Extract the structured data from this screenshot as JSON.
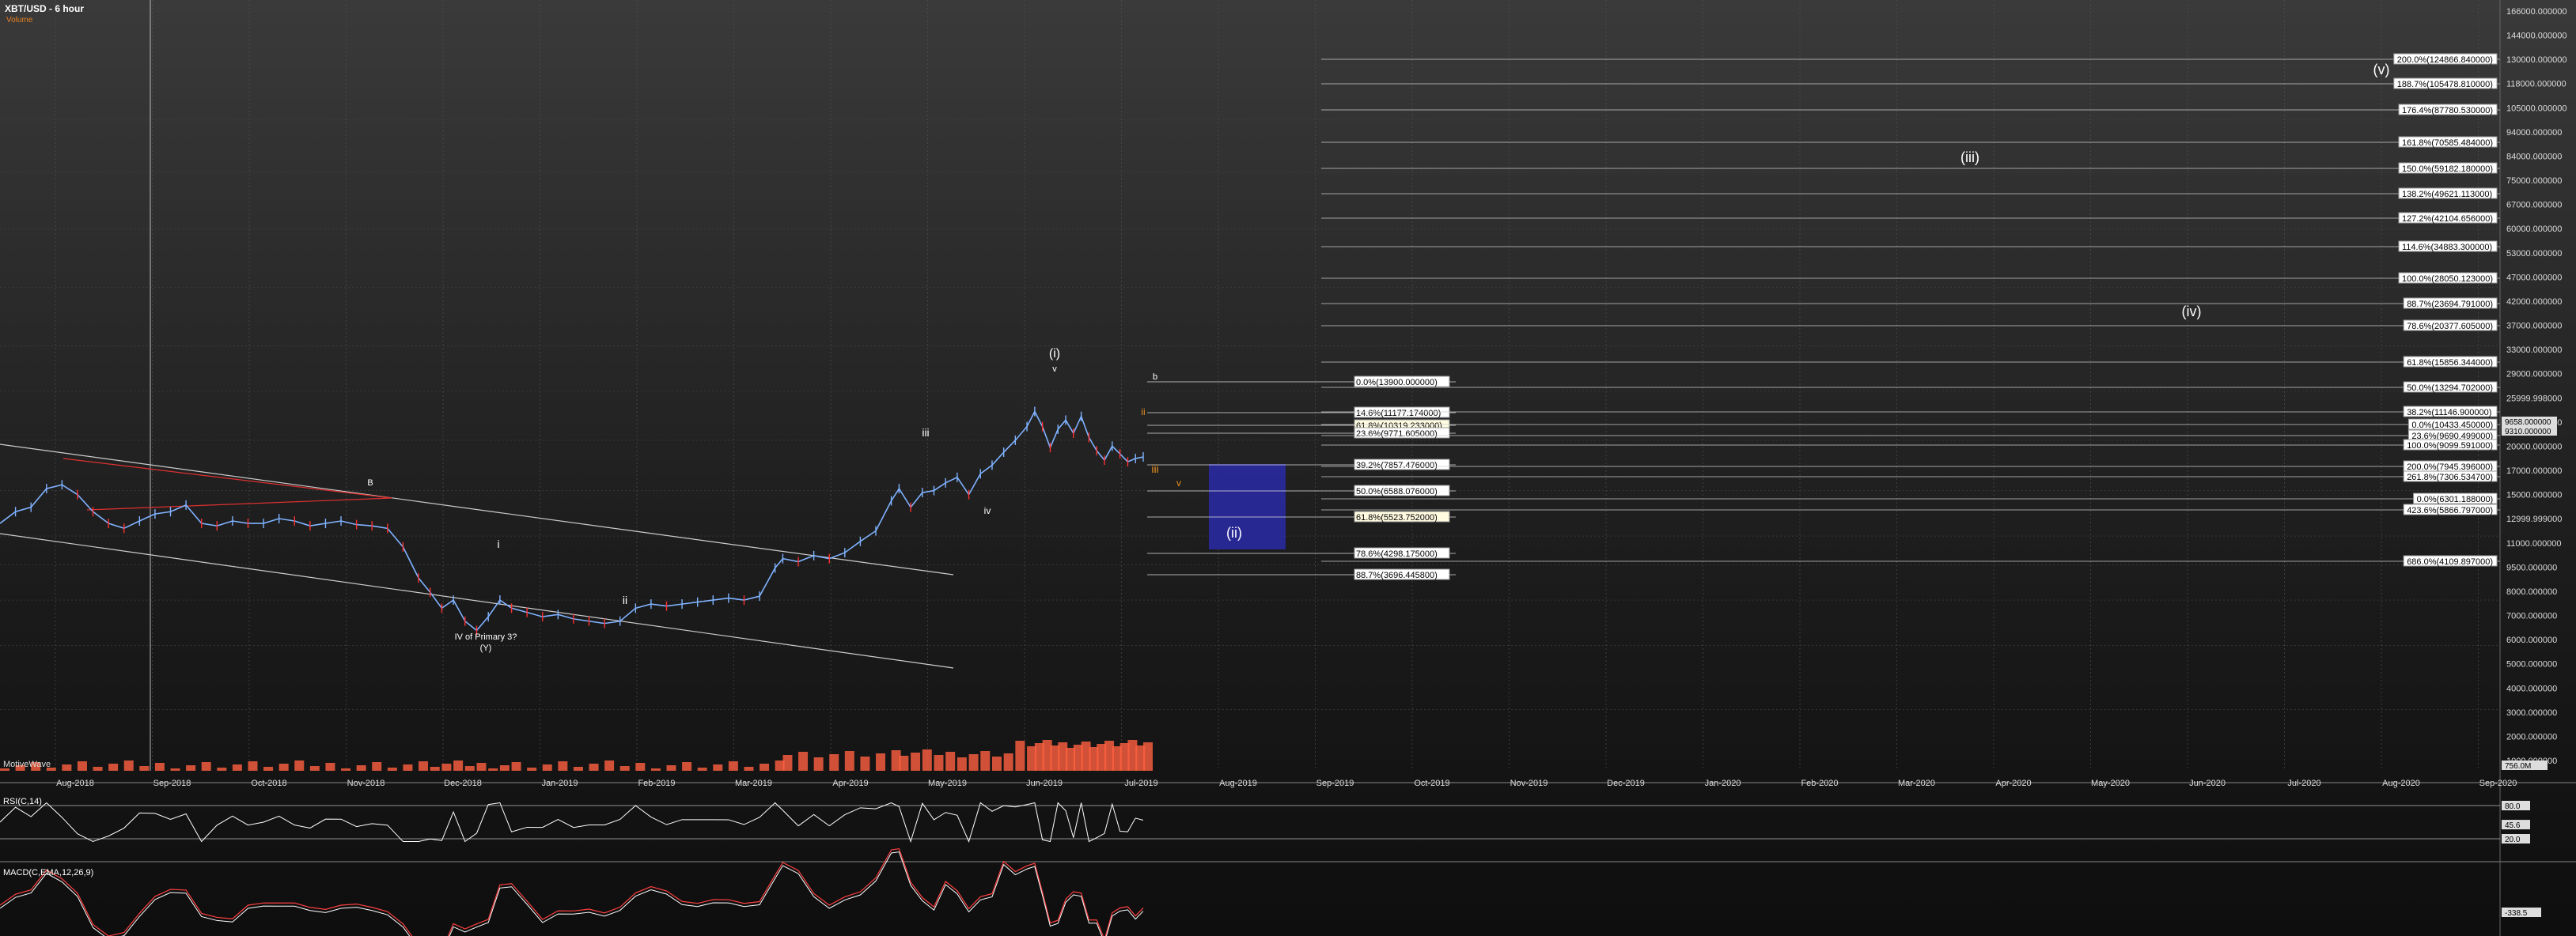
{
  "title": "XBT/USD - 6 hour",
  "subtitle": "Volume",
  "watermark": "MotiveWave",
  "panes": {
    "rsi_label": "RSI(C,14)",
    "macd_label": "MACD(C,EMA,12,26,9)"
  },
  "colors": {
    "bg": "#1e1e1e",
    "up": "#7fb2ff",
    "down": "#ff3030",
    "fib_box": "#2a2aa8",
    "orange": "#e8901e"
  },
  "chart_data": {
    "type": "line",
    "title": "XBT/USD - 6 hour",
    "y_scale": "log",
    "ylim": [
      1500,
      170000
    ],
    "x_ticks": [
      "Aug-2018",
      "Sep-2018",
      "Oct-2018",
      "Nov-2018",
      "Dec-2018",
      "Jan-2019",
      "Feb-2019",
      "Mar-2019",
      "Apr-2019",
      "May-2019",
      "Jun-2019",
      "Jul-2019",
      "Aug-2019",
      "Sep-2019",
      "Oct-2019",
      "Nov-2019",
      "Dec-2019",
      "Jan-2020",
      "Feb-2020",
      "Mar-2020",
      "Apr-2020",
      "May-2020",
      "Jun-2020",
      "Jul-2020",
      "Aug-2020",
      "Sep-2020"
    ],
    "y_ticks": [
      "166000.000000",
      "144000.000000",
      "130000.000000",
      "118000.000000",
      "105000.000000",
      "94000.000000",
      "84000.000000",
      "75000.000000",
      "67000.000000",
      "60000.000000",
      "53000.000000",
      "47000.000000",
      "42000.000000",
      "37000.000000",
      "33000.000000",
      "29000.000000",
      "25999.998000",
      "23000.000000",
      "20000.000000",
      "17000.000000",
      "15000.000000",
      "12999.999000",
      "11000.000000",
      "9500.000000",
      "8000.000000",
      "7000.000000",
      "6000.000000",
      "5000.000000",
      "4000.000000",
      "3000.000000",
      "2000.000000",
      "1000.000000"
    ],
    "price_badges": [
      "9658.000000",
      "9310.000000"
    ],
    "volume_badge": "756.0M",
    "rsi_badges": [
      "80.0",
      "45.6",
      "20.0"
    ],
    "macd_badge": "-338.5",
    "price": [
      {
        "x": 0,
        "y": 6500
      },
      {
        "x": 20,
        "y": 7000
      },
      {
        "x": 40,
        "y": 7200
      },
      {
        "x": 60,
        "y": 8100
      },
      {
        "x": 80,
        "y": 8300
      },
      {
        "x": 100,
        "y": 7800
      },
      {
        "x": 120,
        "y": 7000
      },
      {
        "x": 140,
        "y": 6500
      },
      {
        "x": 160,
        "y": 6300
      },
      {
        "x": 180,
        "y": 6600
      },
      {
        "x": 200,
        "y": 6900
      },
      {
        "x": 220,
        "y": 7000
      },
      {
        "x": 240,
        "y": 7300
      },
      {
        "x": 260,
        "y": 6500
      },
      {
        "x": 280,
        "y": 6400
      },
      {
        "x": 300,
        "y": 6600
      },
      {
        "x": 320,
        "y": 6500
      },
      {
        "x": 340,
        "y": 6500
      },
      {
        "x": 360,
        "y": 6700
      },
      {
        "x": 380,
        "y": 6600
      },
      {
        "x": 400,
        "y": 6400
      },
      {
        "x": 420,
        "y": 6500
      },
      {
        "x": 440,
        "y": 6600
      },
      {
        "x": 460,
        "y": 6450
      },
      {
        "x": 480,
        "y": 6400
      },
      {
        "x": 500,
        "y": 6300
      },
      {
        "x": 520,
        "y": 5600
      },
      {
        "x": 540,
        "y": 4600
      },
      {
        "x": 555,
        "y": 4200
      },
      {
        "x": 570,
        "y": 3800
      },
      {
        "x": 585,
        "y": 4000
      },
      {
        "x": 600,
        "y": 3500
      },
      {
        "x": 615,
        "y": 3300
      },
      {
        "x": 630,
        "y": 3600
      },
      {
        "x": 645,
        "y": 4000
      },
      {
        "x": 660,
        "y": 3800
      },
      {
        "x": 680,
        "y": 3700
      },
      {
        "x": 700,
        "y": 3600
      },
      {
        "x": 720,
        "y": 3650
      },
      {
        "x": 740,
        "y": 3550
      },
      {
        "x": 760,
        "y": 3500
      },
      {
        "x": 780,
        "y": 3450
      },
      {
        "x": 800,
        "y": 3500
      },
      {
        "x": 820,
        "y": 3800
      },
      {
        "x": 840,
        "y": 3900
      },
      {
        "x": 860,
        "y": 3850
      },
      {
        "x": 880,
        "y": 3900
      },
      {
        "x": 900,
        "y": 3950
      },
      {
        "x": 920,
        "y": 4000
      },
      {
        "x": 940,
        "y": 4050
      },
      {
        "x": 960,
        "y": 4000
      },
      {
        "x": 980,
        "y": 4100
      },
      {
        "x": 1000,
        "y": 4900
      },
      {
        "x": 1010,
        "y": 5200
      },
      {
        "x": 1030,
        "y": 5100
      },
      {
        "x": 1050,
        "y": 5300
      },
      {
        "x": 1070,
        "y": 5200
      },
      {
        "x": 1090,
        "y": 5400
      },
      {
        "x": 1110,
        "y": 5800
      },
      {
        "x": 1130,
        "y": 6200
      },
      {
        "x": 1150,
        "y": 7500
      },
      {
        "x": 1160,
        "y": 8100
      },
      {
        "x": 1175,
        "y": 7200
      },
      {
        "x": 1190,
        "y": 7900
      },
      {
        "x": 1205,
        "y": 8000
      },
      {
        "x": 1220,
        "y": 8400
      },
      {
        "x": 1235,
        "y": 8700
      },
      {
        "x": 1250,
        "y": 7800
      },
      {
        "x": 1265,
        "y": 8900
      },
      {
        "x": 1280,
        "y": 9400
      },
      {
        "x": 1295,
        "y": 10200
      },
      {
        "x": 1310,
        "y": 11000
      },
      {
        "x": 1325,
        "y": 12000
      },
      {
        "x": 1335,
        "y": 13200
      },
      {
        "x": 1345,
        "y": 12000
      },
      {
        "x": 1355,
        "y": 10500
      },
      {
        "x": 1365,
        "y": 11800
      },
      {
        "x": 1375,
        "y": 12500
      },
      {
        "x": 1385,
        "y": 11500
      },
      {
        "x": 1395,
        "y": 12800
      },
      {
        "x": 1405,
        "y": 11200
      },
      {
        "x": 1415,
        "y": 10300
      },
      {
        "x": 1425,
        "y": 9700
      },
      {
        "x": 1435,
        "y": 10600
      },
      {
        "x": 1445,
        "y": 10100
      },
      {
        "x": 1455,
        "y": 9600
      },
      {
        "x": 1465,
        "y": 9800
      },
      {
        "x": 1475,
        "y": 9900
      }
    ],
    "fib_levels_right": [
      "200.0%(124866.840000)",
      "188.7%(105478.810000)",
      "176.4%(87780.530000)",
      "161.8%(70585.484000)",
      "150.0%(59182.180000)",
      "138.2%(49621.113000)",
      "127.2%(42104.656000)",
      "114.6%(34883.300000)",
      "100.0%(28050.123000)",
      "88.7%(23694.791000)",
      "78.6%(20377.605000)",
      "61.8%(15856.344000)",
      "50.0%(13294.702000)",
      "38.2%(11146.900000)",
      "0.0%(10433.450000)",
      "23.6%(9690.499000)",
      "100.0%(9099.591000)",
      "200.0%(7945.396000)",
      "261.8%(7306.534700)",
      "0.0%(6301.188000)",
      "423.6%(5866.797000)",
      "686.0%(4109.897000)"
    ],
    "fib_levels_mid": [
      "0.0%(13900.000000)",
      "14.6%(11177.174000)",
      "61.8%(10319.233000)",
      "23.6%(9771.605000)",
      "39.2%(7857.476000)",
      "50.0%(6588.076000)",
      "61.8%(5523.752000)",
      "78.6%(4298.175000)",
      "88.7%(3696.445800)"
    ],
    "wave_labels": [
      "(v)",
      "(iii)",
      "(iv)",
      "(ii)",
      "(i)",
      "v",
      "iii",
      "iv",
      "i",
      "ii",
      "iii",
      "v",
      "b",
      "IV of Primary 3?",
      "(Y)",
      "B",
      "ii"
    ]
  }
}
